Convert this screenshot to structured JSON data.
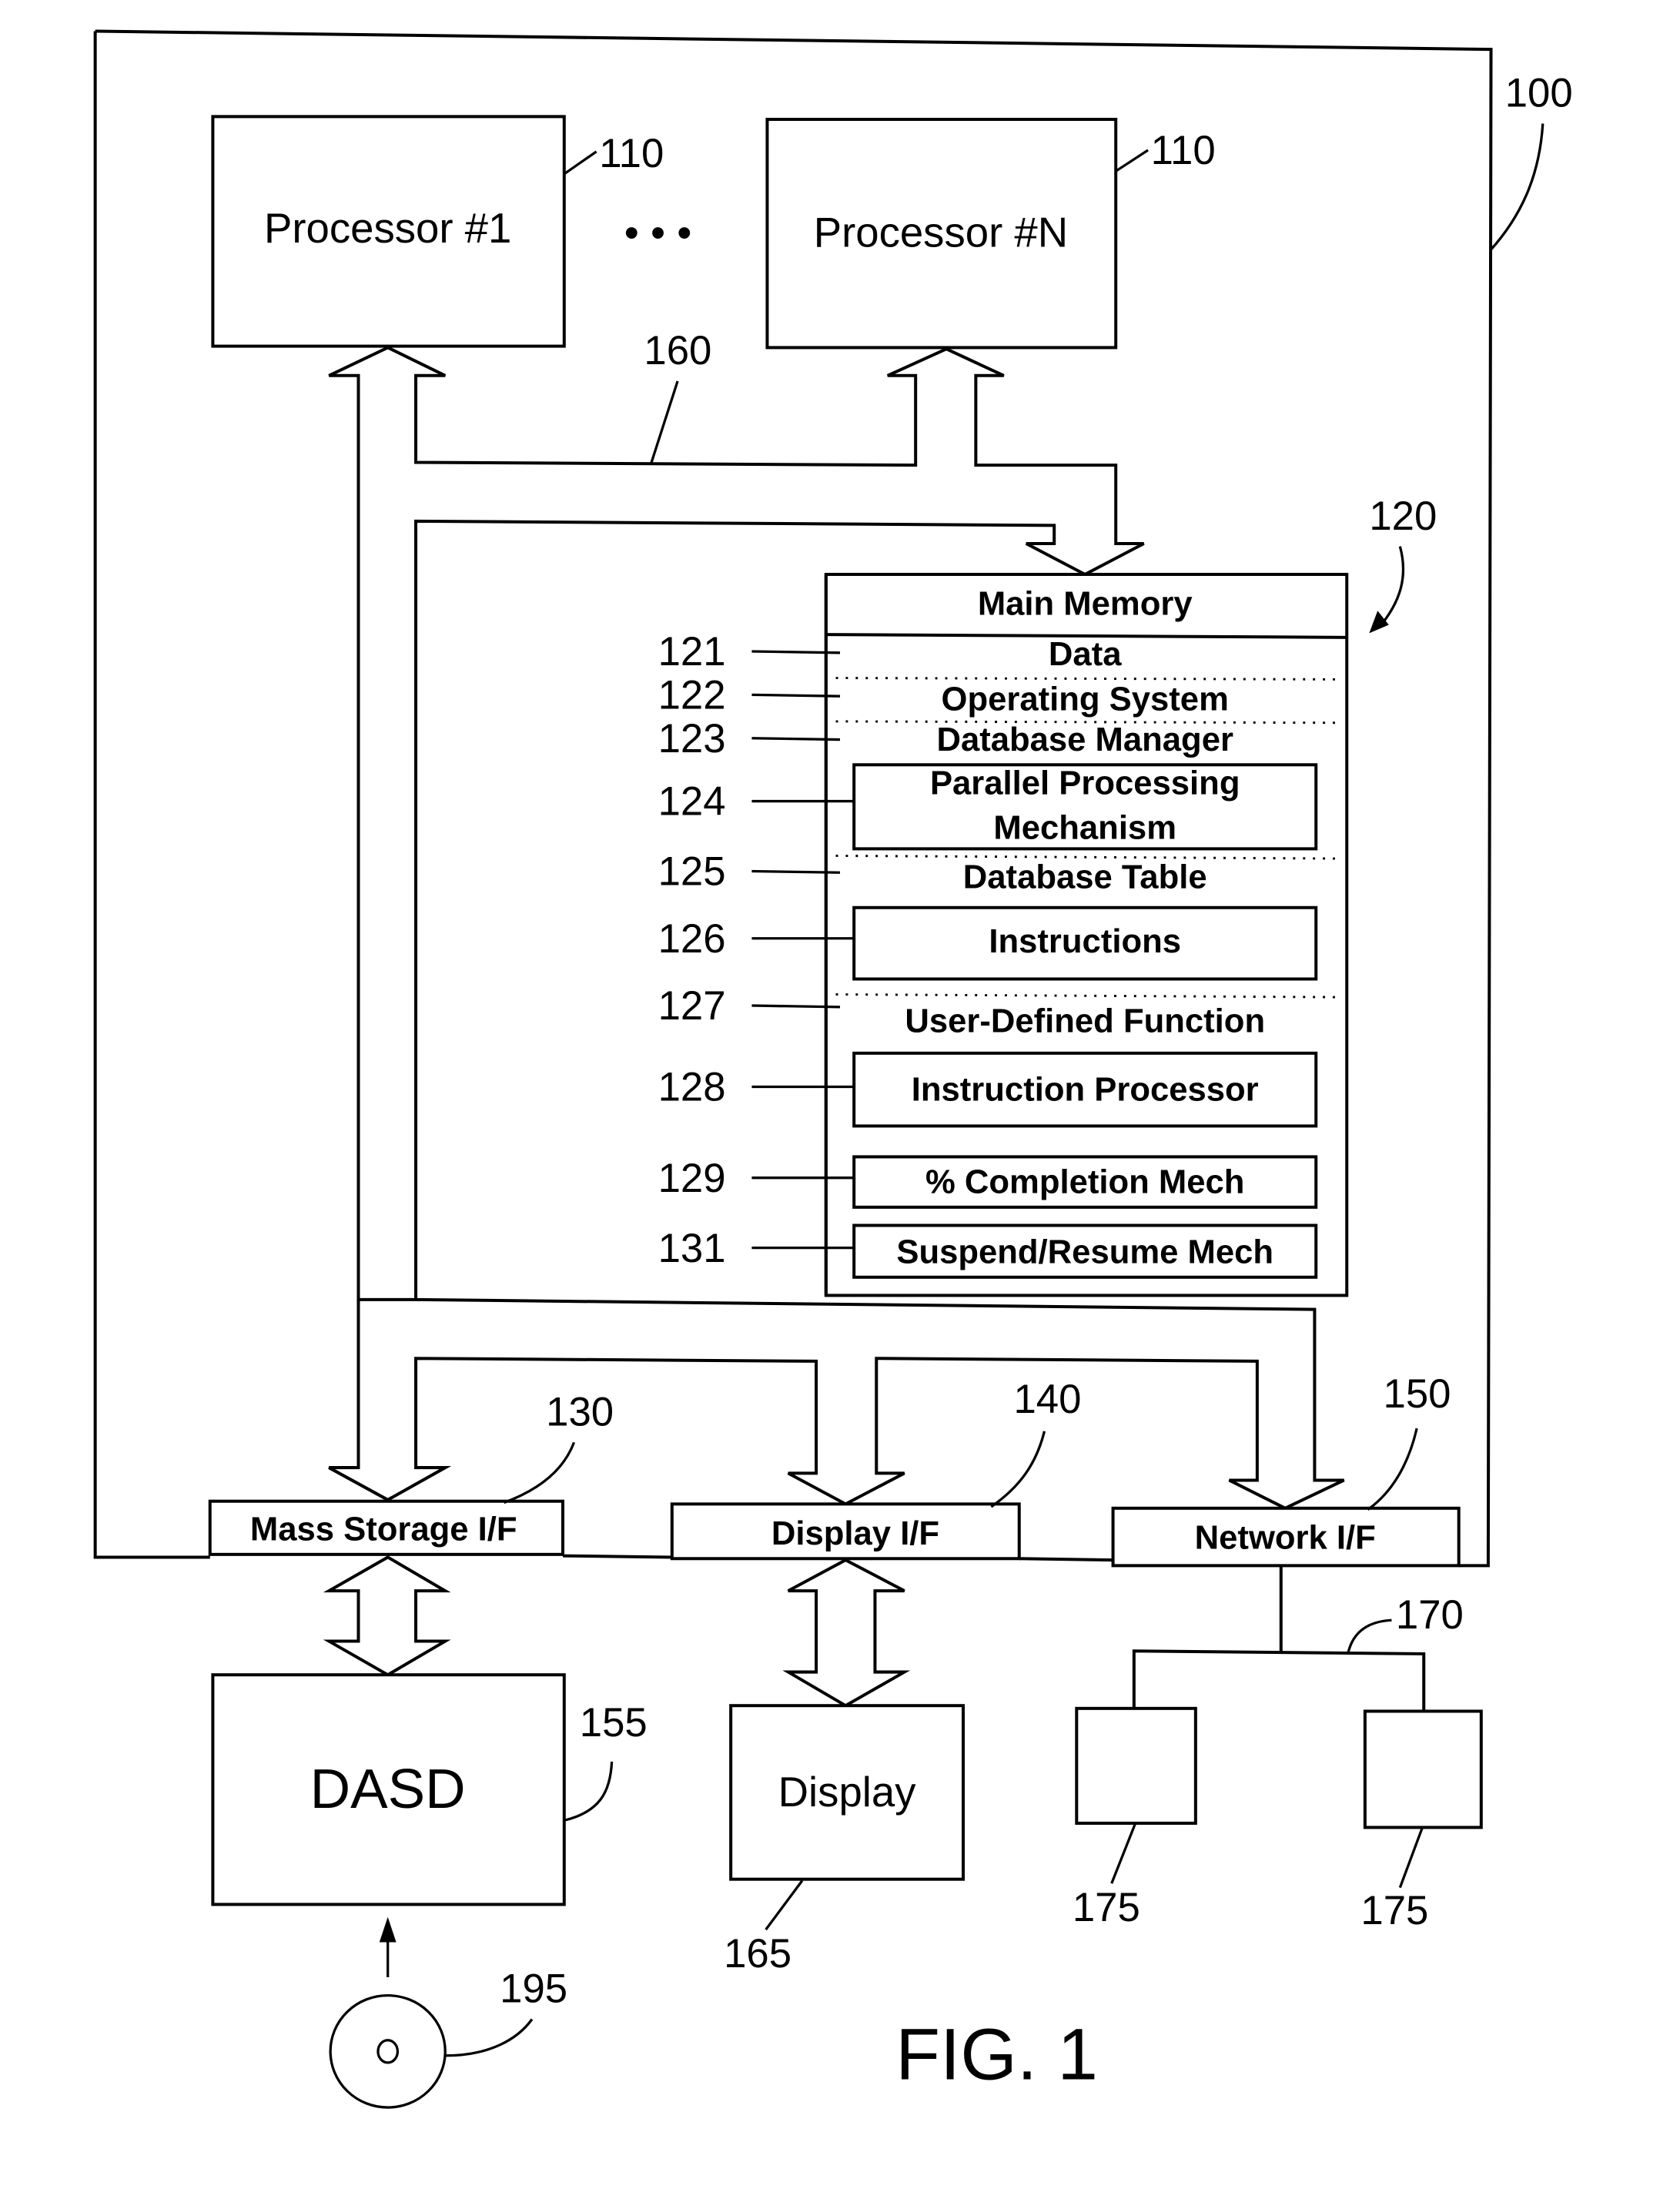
{
  "figure": {
    "caption": "FIG. 1",
    "system_ref": "100"
  },
  "processors": [
    {
      "label": "Processor #1",
      "ref": "110"
    },
    {
      "label": "Processor #N",
      "ref": "110"
    }
  ],
  "ellipsis": "• • •",
  "bus_ref": "160",
  "main_memory": {
    "title": "Main Memory",
    "ref": "120",
    "items": [
      {
        "ref": "121",
        "label": "Data",
        "boxed": false
      },
      {
        "ref": "122",
        "label": "Operating System",
        "boxed": false
      },
      {
        "ref": "123",
        "label": "Database Manager",
        "boxed": false
      },
      {
        "ref": "124",
        "label_line1": "Parallel Processing",
        "label_line2": "Mechanism",
        "boxed": true
      },
      {
        "ref": "125",
        "label": "Database Table",
        "boxed": false
      },
      {
        "ref": "126",
        "label": "Instructions",
        "boxed": true
      },
      {
        "ref": "127",
        "label": "User-Defined Function",
        "boxed": false
      },
      {
        "ref": "128",
        "label": "Instruction Processor",
        "boxed": true
      },
      {
        "ref": "129",
        "label": "% Completion Mech",
        "boxed": true
      },
      {
        "ref": "131",
        "label": "Suspend/Resume Mech",
        "boxed": true
      }
    ]
  },
  "interfaces": [
    {
      "label": "Mass Storage I/F",
      "ref": "130"
    },
    {
      "label": "Display I/F",
      "ref": "140"
    },
    {
      "label": "Network I/F",
      "ref": "150"
    }
  ],
  "external": {
    "dasd": {
      "label": "DASD",
      "ref": "155"
    },
    "display": {
      "label": "Display",
      "ref": "165"
    },
    "network_ref": "170",
    "workstations": [
      {
        "ref": "175"
      },
      {
        "ref": "175"
      }
    ],
    "media": {
      "ref": "195",
      "icon": "disc-icon"
    }
  }
}
